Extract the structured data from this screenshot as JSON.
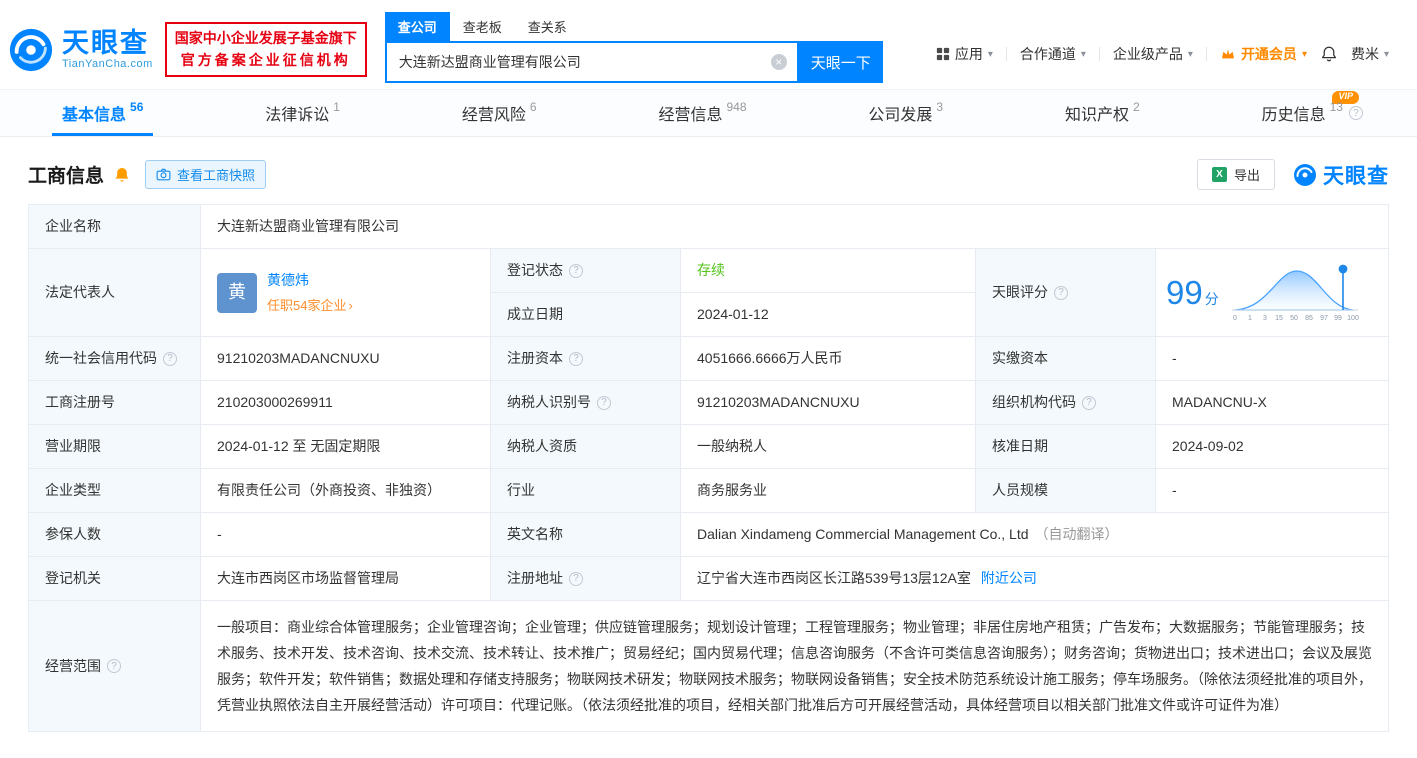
{
  "colors": {
    "accent": "#0084ff",
    "status_green": "#52c41a",
    "vip_orange": "#ff8a00",
    "badge_red": "#e60012",
    "score_blue": "#1f87e8"
  },
  "icons": {
    "caret_down": "▾",
    "help": "?",
    "clear": "×",
    "arrow_right": "›",
    "xls": "X"
  },
  "header": {
    "brand": "天眼查",
    "brand_domain": "TianYanCha.com",
    "badge": {
      "line1": "国家中小企业发展子基金旗下",
      "line2": "官方备案企业征信机构"
    },
    "search": {
      "tabs": [
        {
          "label": "查公司",
          "active": true
        },
        {
          "label": "查老板",
          "active": false
        },
        {
          "label": "查关系",
          "active": false
        }
      ],
      "value": "大连新达盟商业管理有限公司",
      "button": "天眼一下"
    },
    "nav": {
      "apps": "应用",
      "partner": "合作通道",
      "enterprise": "企业级产品",
      "vip": "开通会员",
      "user": "费米"
    }
  },
  "tabs": [
    {
      "label": "基本信息",
      "count": "56",
      "active": true
    },
    {
      "label": "法律诉讼",
      "count": "1"
    },
    {
      "label": "经营风险",
      "count": "6"
    },
    {
      "label": "经营信息",
      "count": "948"
    },
    {
      "label": "公司发展",
      "count": "3"
    },
    {
      "label": "知识产权",
      "count": "2"
    },
    {
      "label": "历史信息",
      "count": "13",
      "vip": "VIP"
    }
  ],
  "section": {
    "title": "工商信息",
    "snapshot": "查看工商快照",
    "export": "导出",
    "watermark": "天眼查"
  },
  "info": {
    "company_name_label": "企业名称",
    "company_name": "大连新达盟商业管理有限公司",
    "legal_rep_label": "法定代表人",
    "legal_rep_avatar": "黄",
    "legal_rep_name": "黄德炜",
    "legal_rep_link": "任职54家企业",
    "reg_status_label": "登记状态",
    "reg_status": "存续",
    "establish_date_label": "成立日期",
    "establish_date": "2024-01-12",
    "score_label": "天眼评分",
    "score_value": "99",
    "score_unit": "分",
    "score_ticks": [
      "0",
      "1",
      "3",
      "15",
      "50",
      "85",
      "97",
      "99",
      "100"
    ],
    "credit_code_label": "统一社会信用代码",
    "credit_code": "91210203MADANCNUXU",
    "reg_capital_label": "注册资本",
    "reg_capital": "4051666.6666万人民币",
    "paid_capital_label": "实缴资本",
    "paid_capital": "-",
    "reg_number_label": "工商注册号",
    "reg_number": "210203000269911",
    "taxpayer_id_label": "纳税人识别号",
    "taxpayer_id": "91210203MADANCNUXU",
    "org_code_label": "组织机构代码",
    "org_code": "MADANCNU-X",
    "business_term_label": "营业期限",
    "business_term": "2024-01-12 至 无固定期限",
    "taxpayer_quality_label": "纳税人资质",
    "taxpayer_quality": "一般纳税人",
    "approval_date_label": "核准日期",
    "approval_date": "2024-09-02",
    "company_type_label": "企业类型",
    "company_type": "有限责任公司（外商投资、非独资）",
    "industry_label": "行业",
    "industry": "商务服务业",
    "staff_size_label": "人员规模",
    "staff_size": "-",
    "insured_label": "参保人数",
    "insured": "-",
    "english_name_label": "英文名称",
    "english_name": "Dalian Xindameng Commercial Management Co., Ltd",
    "english_name_note": "（自动翻译）",
    "reg_authority_label": "登记机关",
    "reg_authority": "大连市西岗区市场监督管理局",
    "address_label": "注册地址",
    "address": "辽宁省大连市西岗区长江路539号13层12A室",
    "address_link": "附近公司",
    "scope_label": "经营范围",
    "scope": "一般项目：商业综合体管理服务；企业管理咨询；企业管理；供应链管理服务；规划设计管理；工程管理服务；物业管理；非居住房地产租赁；广告发布；大数据服务；节能管理服务；技术服务、技术开发、技术咨询、技术交流、技术转让、技术推广；贸易经纪；国内贸易代理；信息咨询服务（不含许可类信息咨询服务）；财务咨询；货物进出口；技术进出口；会议及展览服务；软件开发；软件销售；数据处理和存储支持服务；物联网技术研发；物联网技术服务；物联网设备销售；安全技术防范系统设计施工服务；停车场服务。（除依法须经批准的项目外，凭营业执照依法自主开展经营活动）许可项目：代理记账。（依法须经批准的项目，经相关部门批准后方可开展经营活动，具体经营项目以相关部门批准文件或许可证件为准）"
  }
}
